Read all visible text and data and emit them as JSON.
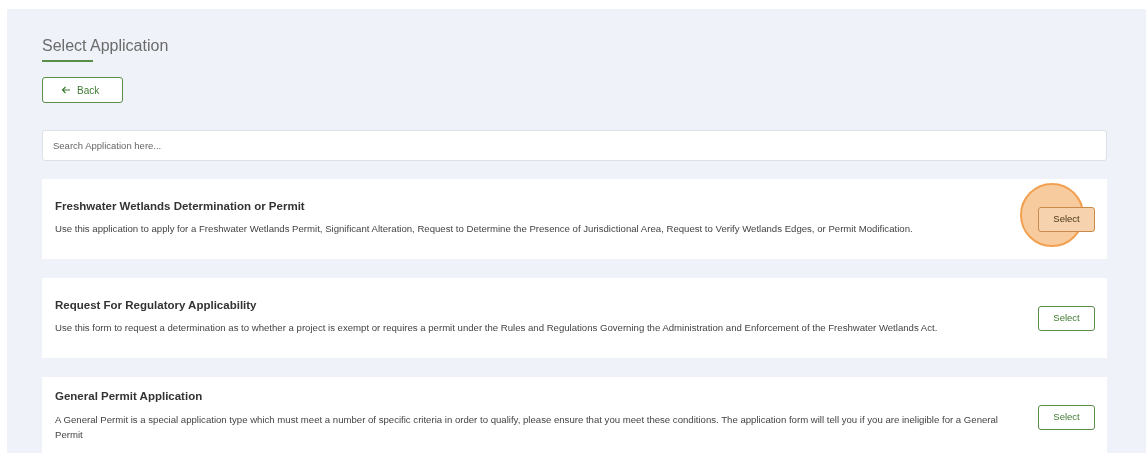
{
  "page_title": "Select Application",
  "back_button": {
    "label": "Back"
  },
  "search": {
    "placeholder": "Search Application here..."
  },
  "applications": [
    {
      "title": "Freshwater Wetlands Determination or Permit",
      "description": "Use this application to apply for a Freshwater Wetlands Permit, Significant Alteration, Request to Determine the Presence of Jurisdictional Area, Request to Verify Wetlands Edges, or Permit Modification.",
      "button": "Select",
      "highlighted": true
    },
    {
      "title": "Request For Regulatory Applicability",
      "description": "Use this form to request a determination as to whether a project is exempt or requires a permit under the Rules and Regulations Governing the Administration and Enforcement of the Freshwater Wetlands Act.",
      "button": "Select",
      "highlighted": false
    },
    {
      "title": "General Permit Application",
      "description": "A General Permit is a special application type which must meet a number of specific criteria in order to qualify, please ensure that you meet these conditions. The application form will tell you if you are ineligible for a General Permit",
      "button": "Select",
      "highlighted": false
    }
  ]
}
